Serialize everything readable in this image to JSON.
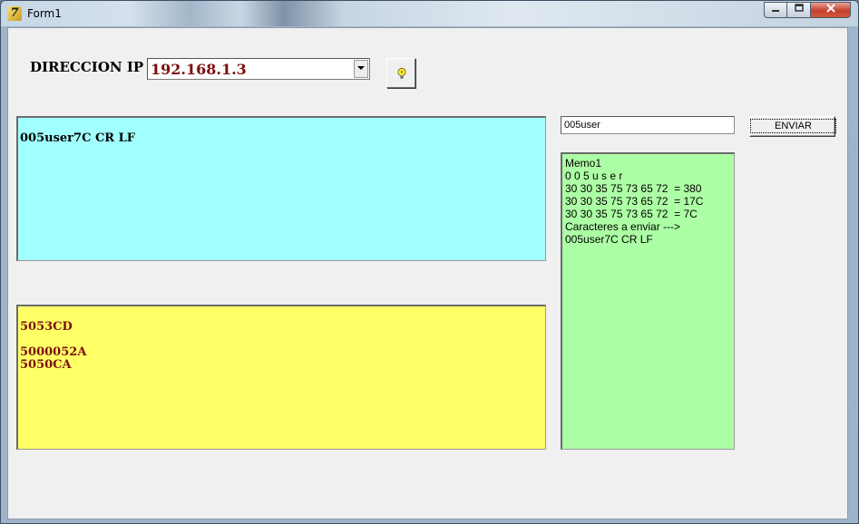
{
  "window": {
    "title": "Form1"
  },
  "form": {
    "ip_label": "DIRECCION IP",
    "ip_value": "192.168.1.3",
    "send_input_value": "005user",
    "send_button_label": "ENVIAR"
  },
  "memos": {
    "cyan": [
      "005user7C CR LF"
    ],
    "yellow": [
      "5053CD",
      "",
      "5000052A",
      "5050CA"
    ],
    "green": [
      "Memo1",
      "0 0 5 u s e r",
      "30 30 35 75 73 65 72  = 380",
      "30 30 35 75 73 65 72  = 17C",
      "30 30 35 75 73 65 72  = 7C",
      "Caracteres a enviar --->",
      "005user7C CR LF"
    ]
  },
  "colors": {
    "cyan_memo": "#a2ffff",
    "yellow_memo": "#ffff66",
    "green_memo": "#adffa5",
    "dark_red_text": "#7b1010"
  },
  "icons": {
    "app": "delphi-icon",
    "ip_button": "lightbulb-icon",
    "combo_arrow": "chevron-down-icon"
  }
}
